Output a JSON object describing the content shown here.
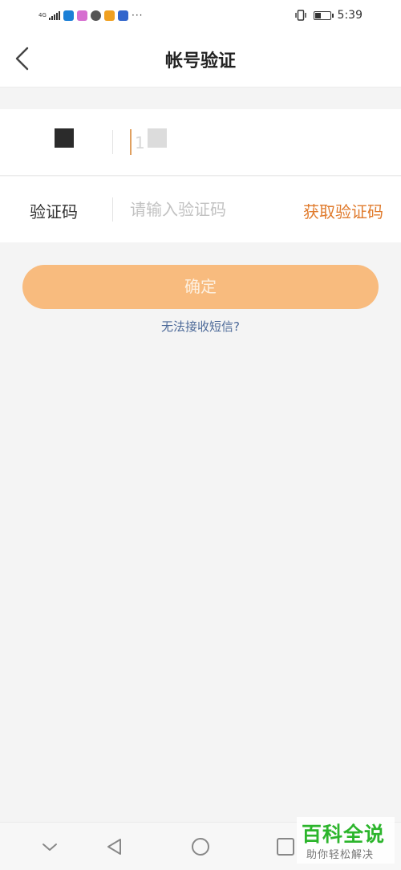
{
  "status_bar": {
    "network_label": "4G",
    "time": "5:39",
    "notification_icons": [
      "qq-icon",
      "soul-icon",
      "wechat-icon",
      "weibo-icon",
      "baidu-icon"
    ],
    "more": "···"
  },
  "nav": {
    "title": "帐号验证",
    "back_icon": "chevron-left-icon"
  },
  "phone_row": {
    "masked": true
  },
  "code_row": {
    "label": "验证码",
    "placeholder": "请输入验证码",
    "value": "",
    "get_code": "获取验证码"
  },
  "confirm_button": {
    "label": "确定",
    "enabled": false
  },
  "cant_receive_link": "无法接收短信?",
  "bottom_nav": [
    "collapse-icon",
    "back-icon",
    "home-icon",
    "recents-icon"
  ],
  "watermark": {
    "title": "百科全说",
    "subtitle": "助你轻松解决"
  },
  "colors": {
    "accent": "#e07b2d",
    "button_disabled": "#f8bb7e",
    "link": "#4d6a99",
    "background": "#f4f4f4"
  }
}
